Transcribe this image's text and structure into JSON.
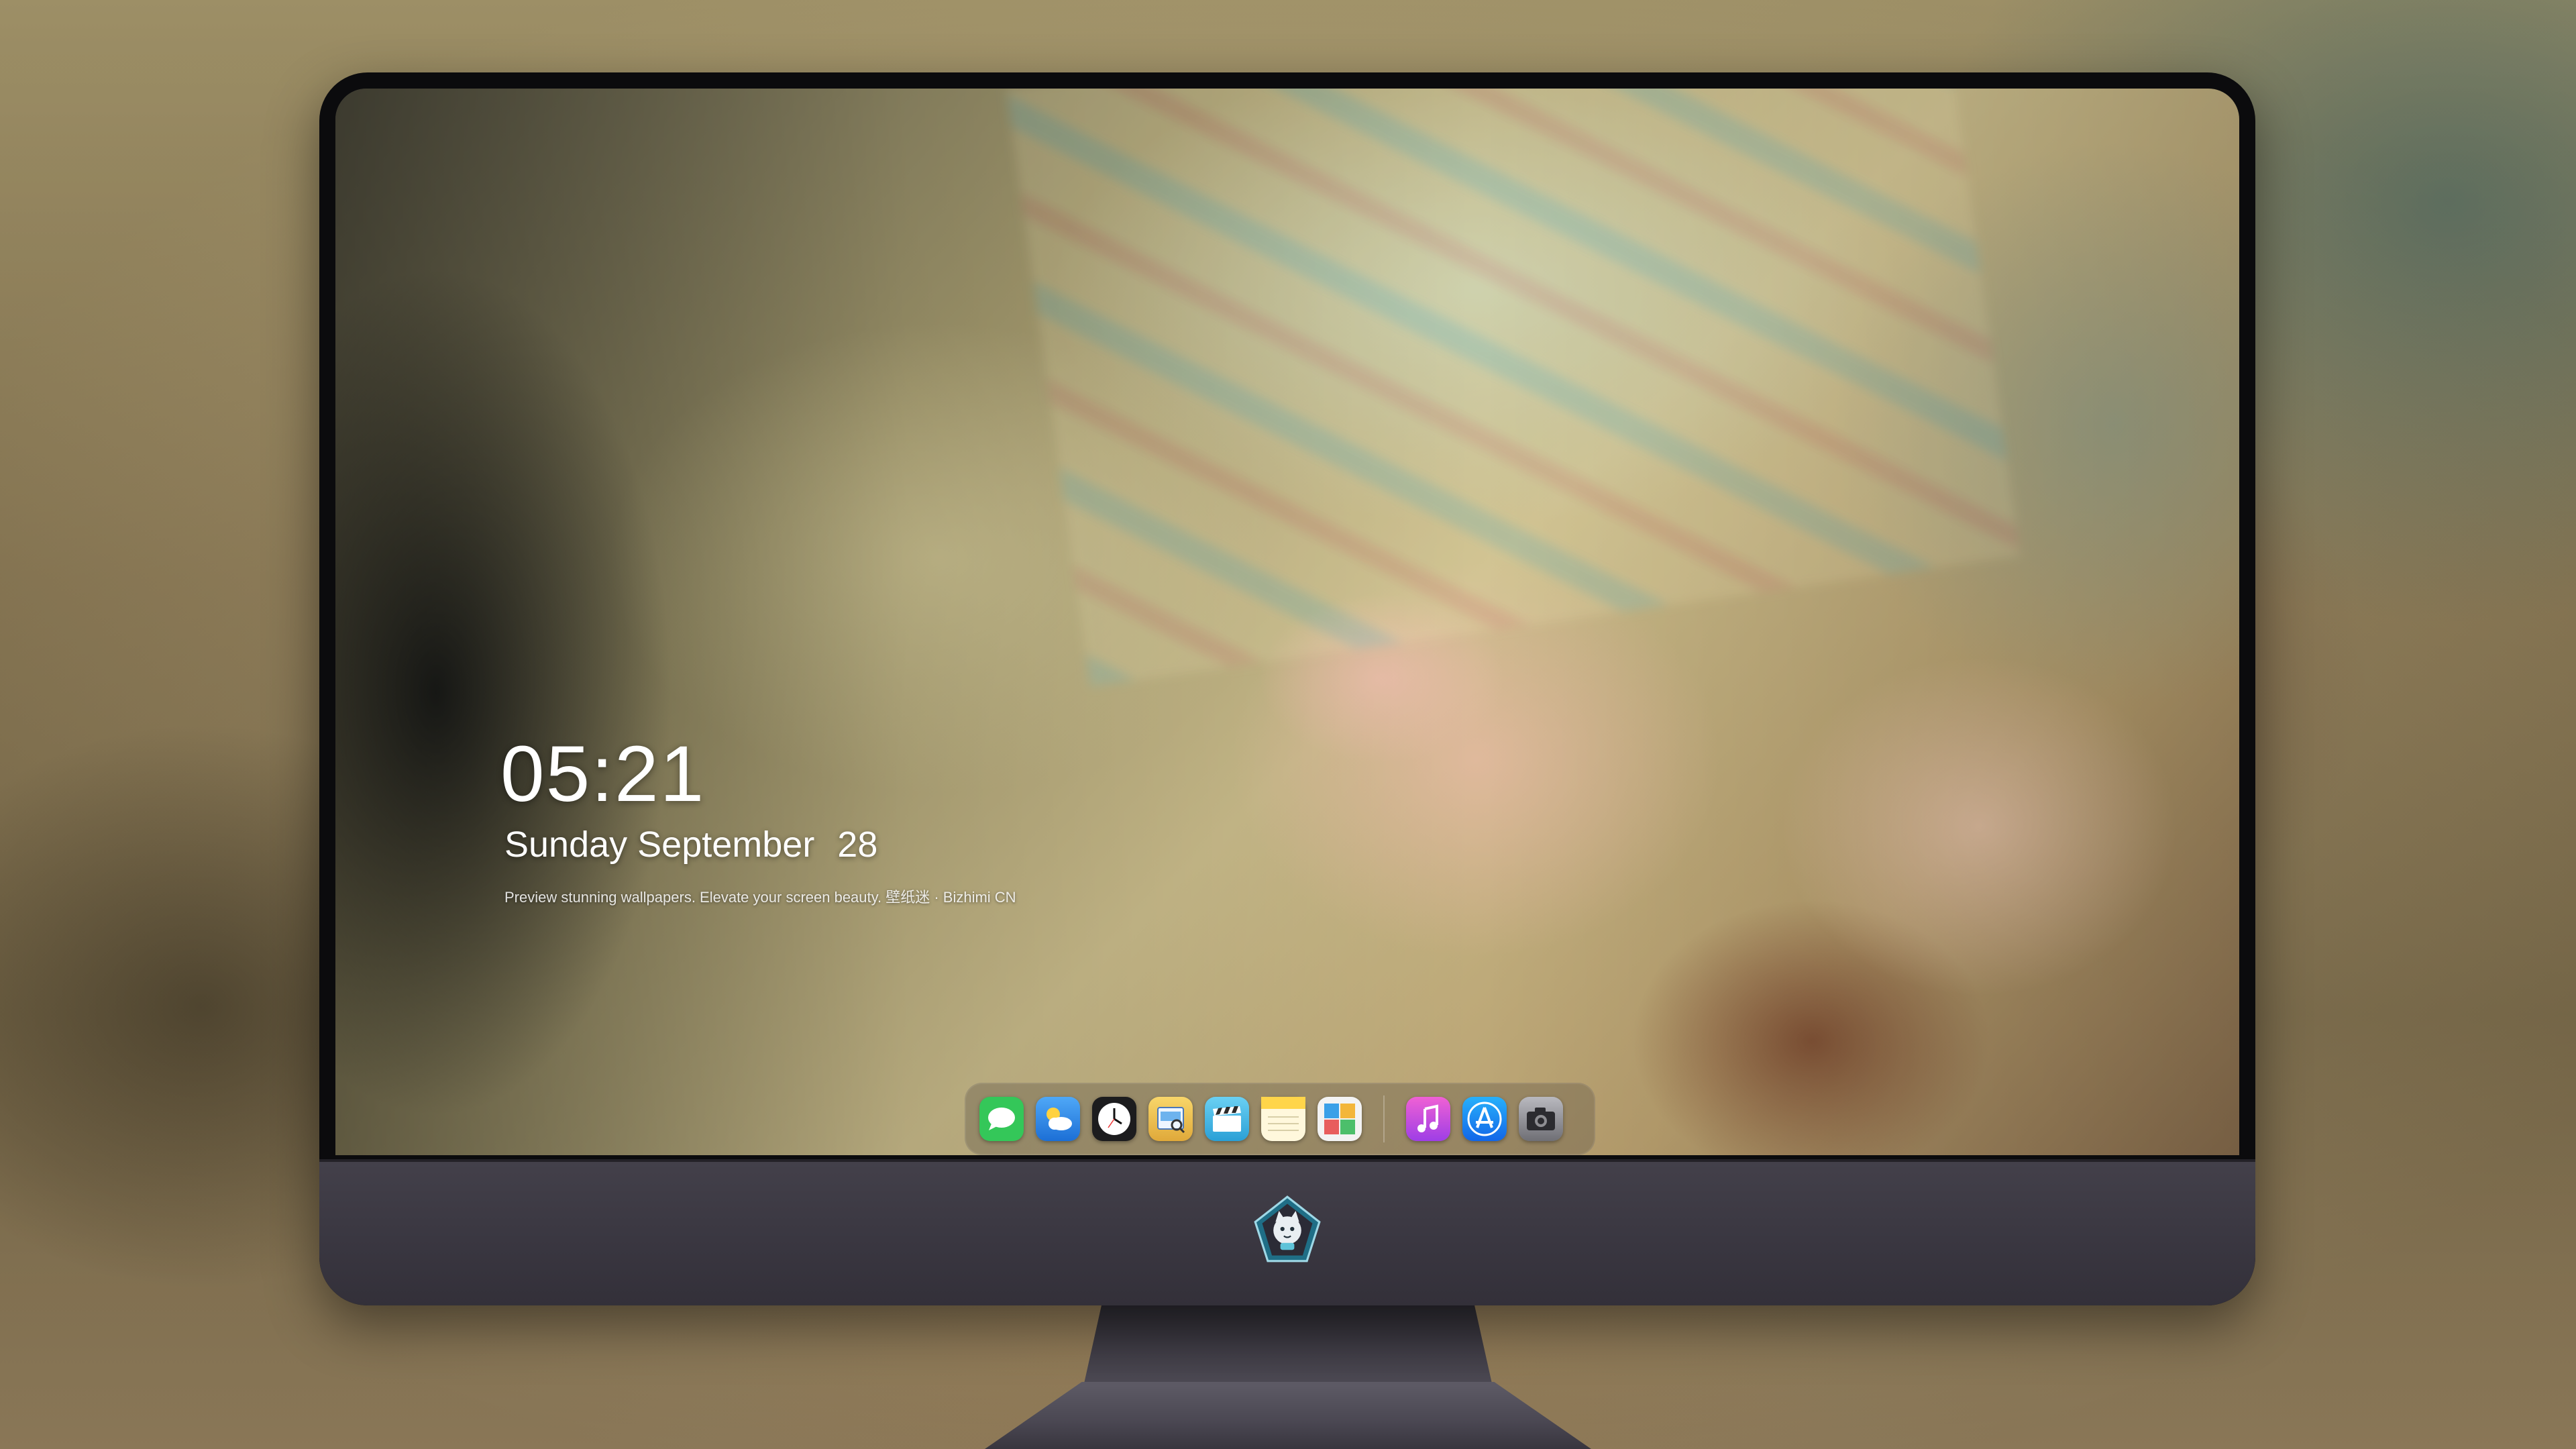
{
  "lockscreen": {
    "time": "05:21",
    "weekday_month": "Sunday September",
    "day": "28",
    "tagline": "Preview stunning wallpapers. Elevate your screen beauty. 壁纸迷 · Bizhimi CN"
  },
  "dock": {
    "apps": [
      {
        "name": "Messages",
        "icon": "messages-icon",
        "color": "#34c759"
      },
      {
        "name": "Weather",
        "icon": "weather-icon",
        "color": "#2f8cf0"
      },
      {
        "name": "Clock",
        "icon": "clock-icon",
        "color": "#1c1c1e"
      },
      {
        "name": "Preview",
        "icon": "preview-icon",
        "color": "#f2c94c"
      },
      {
        "name": "Clips",
        "icon": "clapperboard-icon",
        "color": "#3fb7e6"
      },
      {
        "name": "Notes",
        "icon": "notes-icon",
        "color": "#ffd54a"
      },
      {
        "name": "Photos",
        "icon": "photos-icon",
        "color": "#f3f3f3"
      },
      {
        "name": "iTunes",
        "icon": "music-icon",
        "color": "#c84fe0"
      },
      {
        "name": "App Store",
        "icon": "app-store-icon",
        "color": "#1a8cf5"
      },
      {
        "name": "Camera",
        "icon": "camera-icon",
        "color": "#8e8e93"
      }
    ]
  },
  "monitor": {
    "chin_logo": "cat-mascot-logo",
    "bezel_color": "#0b0b0d",
    "chin_color": "#3d3a44"
  }
}
